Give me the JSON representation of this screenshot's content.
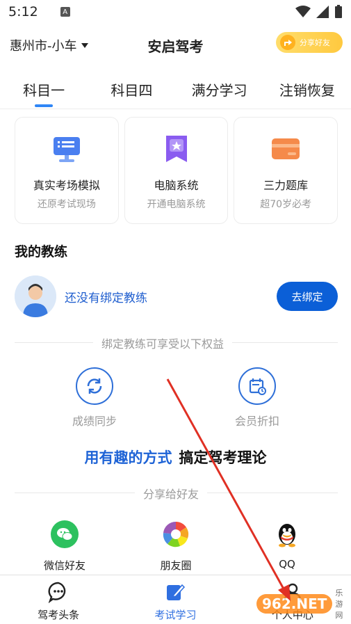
{
  "status": {
    "time": "5:12"
  },
  "header": {
    "city": "惠州市-小车",
    "title": "安启驾考",
    "share_label": "分享好友"
  },
  "tabs": [
    {
      "label": "科目一",
      "active": true
    },
    {
      "label": "科目四",
      "active": false
    },
    {
      "label": "满分学习",
      "active": false
    },
    {
      "label": "注销恢复",
      "active": false
    }
  ],
  "cards": [
    {
      "title": "真实考场模拟",
      "subtitle": "还原考试现场",
      "icon": "monitor-icon",
      "color": "#4a7ff0"
    },
    {
      "title": "电脑系统",
      "subtitle": "开通电脑系统",
      "icon": "bookmark-star-icon",
      "color": "#8a5cf0"
    },
    {
      "title": "三力题库",
      "subtitle": "超70岁必考",
      "icon": "card-icon",
      "color": "#f58a4a"
    }
  ],
  "coach": {
    "section_title": "我的教练",
    "status_text": "还没有绑定教练",
    "bind_label": "去绑定",
    "benefits_header": "绑定教练可享受以下权益",
    "benefits": [
      {
        "label": "成绩同步",
        "icon": "sync-icon"
      },
      {
        "label": "会员折扣",
        "icon": "calendar-discount-icon"
      }
    ]
  },
  "slogan": {
    "part1": "用有趣的方式",
    "part2": "搞定驾考理论"
  },
  "share": {
    "header": "分享给好友",
    "items": [
      {
        "label": "微信好友",
        "icon": "wechat-icon",
        "color": "#2dc15f"
      },
      {
        "label": "朋友圈",
        "icon": "moments-icon",
        "color": "#f5a623"
      },
      {
        "label": "QQ",
        "icon": "qq-icon",
        "color": "#111111"
      }
    ]
  },
  "bottom_nav": [
    {
      "label": "驾考头条",
      "icon": "chat-bubble-icon",
      "active": false
    },
    {
      "label": "考试学习",
      "icon": "pencil-note-icon",
      "active": true
    },
    {
      "label": "个人中心",
      "icon": "profile-icon",
      "active": false
    }
  ],
  "watermark": {
    "badge": "962.NET",
    "sub": "乐游网"
  }
}
